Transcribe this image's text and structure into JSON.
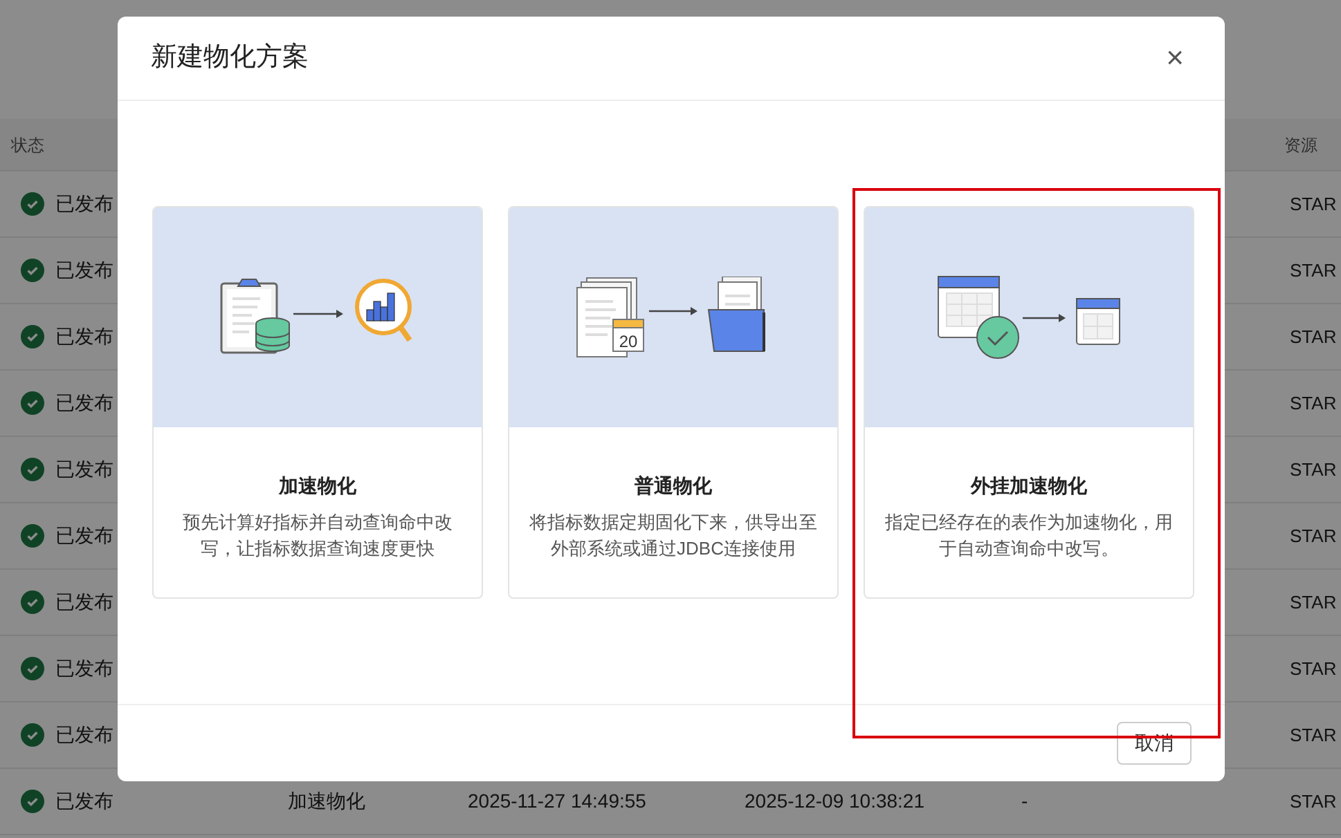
{
  "table": {
    "columns": [
      {
        "label": "状态"
      },
      {},
      {},
      {},
      {},
      {
        "label": "资源"
      }
    ],
    "rows": [
      {
        "status": "已发布",
        "published": true,
        "cells": [
          "",
          "",
          "",
          "",
          "STAR"
        ]
      },
      {
        "status": "已发布",
        "published": true,
        "cells": [
          "",
          "",
          "",
          "",
          "STAR"
        ]
      },
      {
        "status": "已发布",
        "published": true,
        "cells": [
          "",
          "",
          "",
          "",
          "STAR"
        ]
      },
      {
        "status": "已发布",
        "published": true,
        "cells": [
          "",
          "",
          "",
          "",
          "STAR"
        ]
      },
      {
        "status": "已发布",
        "published": true,
        "cells": [
          "",
          "",
          "",
          "",
          "STAR"
        ]
      },
      {
        "status": "已发布",
        "published": true,
        "cells": [
          "",
          "",
          "",
          "",
          "STAR"
        ]
      },
      {
        "status": "已发布",
        "published": true,
        "cells": [
          "",
          "",
          "",
          "",
          "STAR"
        ]
      },
      {
        "status": "已发布",
        "published": true,
        "cells": [
          "",
          "",
          "",
          "",
          "STAR"
        ]
      },
      {
        "status": "已发布",
        "published": true,
        "cells": [
          "",
          "",
          "",
          "",
          "STAR"
        ]
      },
      {
        "status": "已发布",
        "published": true,
        "cells": [
          "加速物化",
          "2025-11-27 14:49:55",
          "2025-12-09 10:38:21",
          "-",
          "STAR"
        ]
      }
    ]
  },
  "dialog": {
    "title": "新建物化方案",
    "close": "×",
    "options": [
      {
        "kind": "accelerate",
        "title": "加速物化",
        "description": "预先计算好指标并自动查询命中改写，让指标数据查询速度更快",
        "selected": false
      },
      {
        "kind": "regular",
        "title": "普通物化",
        "description": "将指标数据定期固化下来，供导出至外部系统或通过JDBC连接使用",
        "selected": false,
        "calendar_day": "20"
      },
      {
        "kind": "external",
        "title": "外挂加速物化",
        "description": "指定已经存在的表作为加速物化，用于自动查询命中改写。",
        "selected": true
      }
    ],
    "cancel": "取消"
  }
}
